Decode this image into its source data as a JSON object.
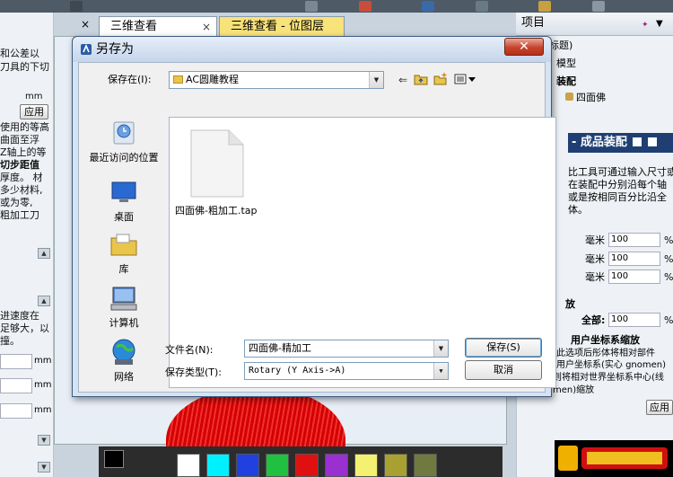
{
  "background": {
    "tabs": [
      {
        "label": "三维查看"
      },
      {
        "label": "三维查看 - 位图层"
      }
    ],
    "tab_close_glyph": "×",
    "left_panel": {
      "text_lines": [
        "和公差以",
        "刀具的下切",
        "使用的等高",
        "曲面至浮",
        "Z轴上的等",
        "切步距值",
        "厚度。 材",
        "多少材料,",
        "或为零,",
        "粗加工刀",
        "进速度在",
        "足够大，以",
        "撞。"
      ],
      "units": [
        "mm",
        "mm",
        "mm",
        "mm"
      ],
      "apply_button": "应用",
      "panel_tab_fragment": "保"
    },
    "right_panel": {
      "title": "项目",
      "tree_items": [
        "标题)",
        "模型",
        "装配",
        "四面佛"
      ],
      "assembly_header": "- 成品装配 ",
      "description_lines": [
        "比工具可通过输入尺寸或",
        "在装配中分别沿每个轴",
        "或是按相同百分比沿全",
        "体。"
      ],
      "scale_rows": [
        {
          "label": "毫米",
          "value": "100",
          "unit": "%"
        },
        {
          "label": "毫米",
          "value": "100",
          "unit": "%"
        },
        {
          "label": "毫米",
          "value": "100",
          "unit": "%"
        }
      ],
      "scale_section": "放",
      "all_label": "全部:",
      "all_value": "100",
      "all_unit": "%",
      "user_coord_title": "用户坐标系缩放",
      "user_coord_lines": [
        "此选项后彤体将相对部件",
        "用户坐标系(实心 gnomen)",
        "则将相对世界坐标系中心(线",
        "men)缩放"
      ],
      "apply_button": "应用"
    },
    "palette_colors": [
      "#ffffff",
      "#00f0ff",
      "#2040e0",
      "#20c040",
      "#e01010",
      "#9a30d0",
      "#f4f070",
      "#a8a030",
      "#707a40"
    ]
  },
  "dialog": {
    "title": "另存为",
    "close_glyph": "✕",
    "save_in_label": "保存在(I):",
    "save_in_value": "AC圆雕教程",
    "places": [
      {
        "label": "最近访问的位置",
        "icon": "recent-places-icon"
      },
      {
        "label": "桌面",
        "icon": "desktop-icon"
      },
      {
        "label": "库",
        "icon": "libraries-icon"
      },
      {
        "label": "计算机",
        "icon": "computer-icon"
      },
      {
        "label": "网络",
        "icon": "network-icon"
      }
    ],
    "files": [
      {
        "name": "四面佛-粗加工.tap",
        "icon": "file-icon"
      }
    ],
    "filename_label": "文件名(N):",
    "filename_value": "四面佛-精加工",
    "filetype_label": "保存类型(T):",
    "filetype_value": "Rotary (Y Axis->A)",
    "save_button": "保存(S)",
    "cancel_button": "取消"
  }
}
